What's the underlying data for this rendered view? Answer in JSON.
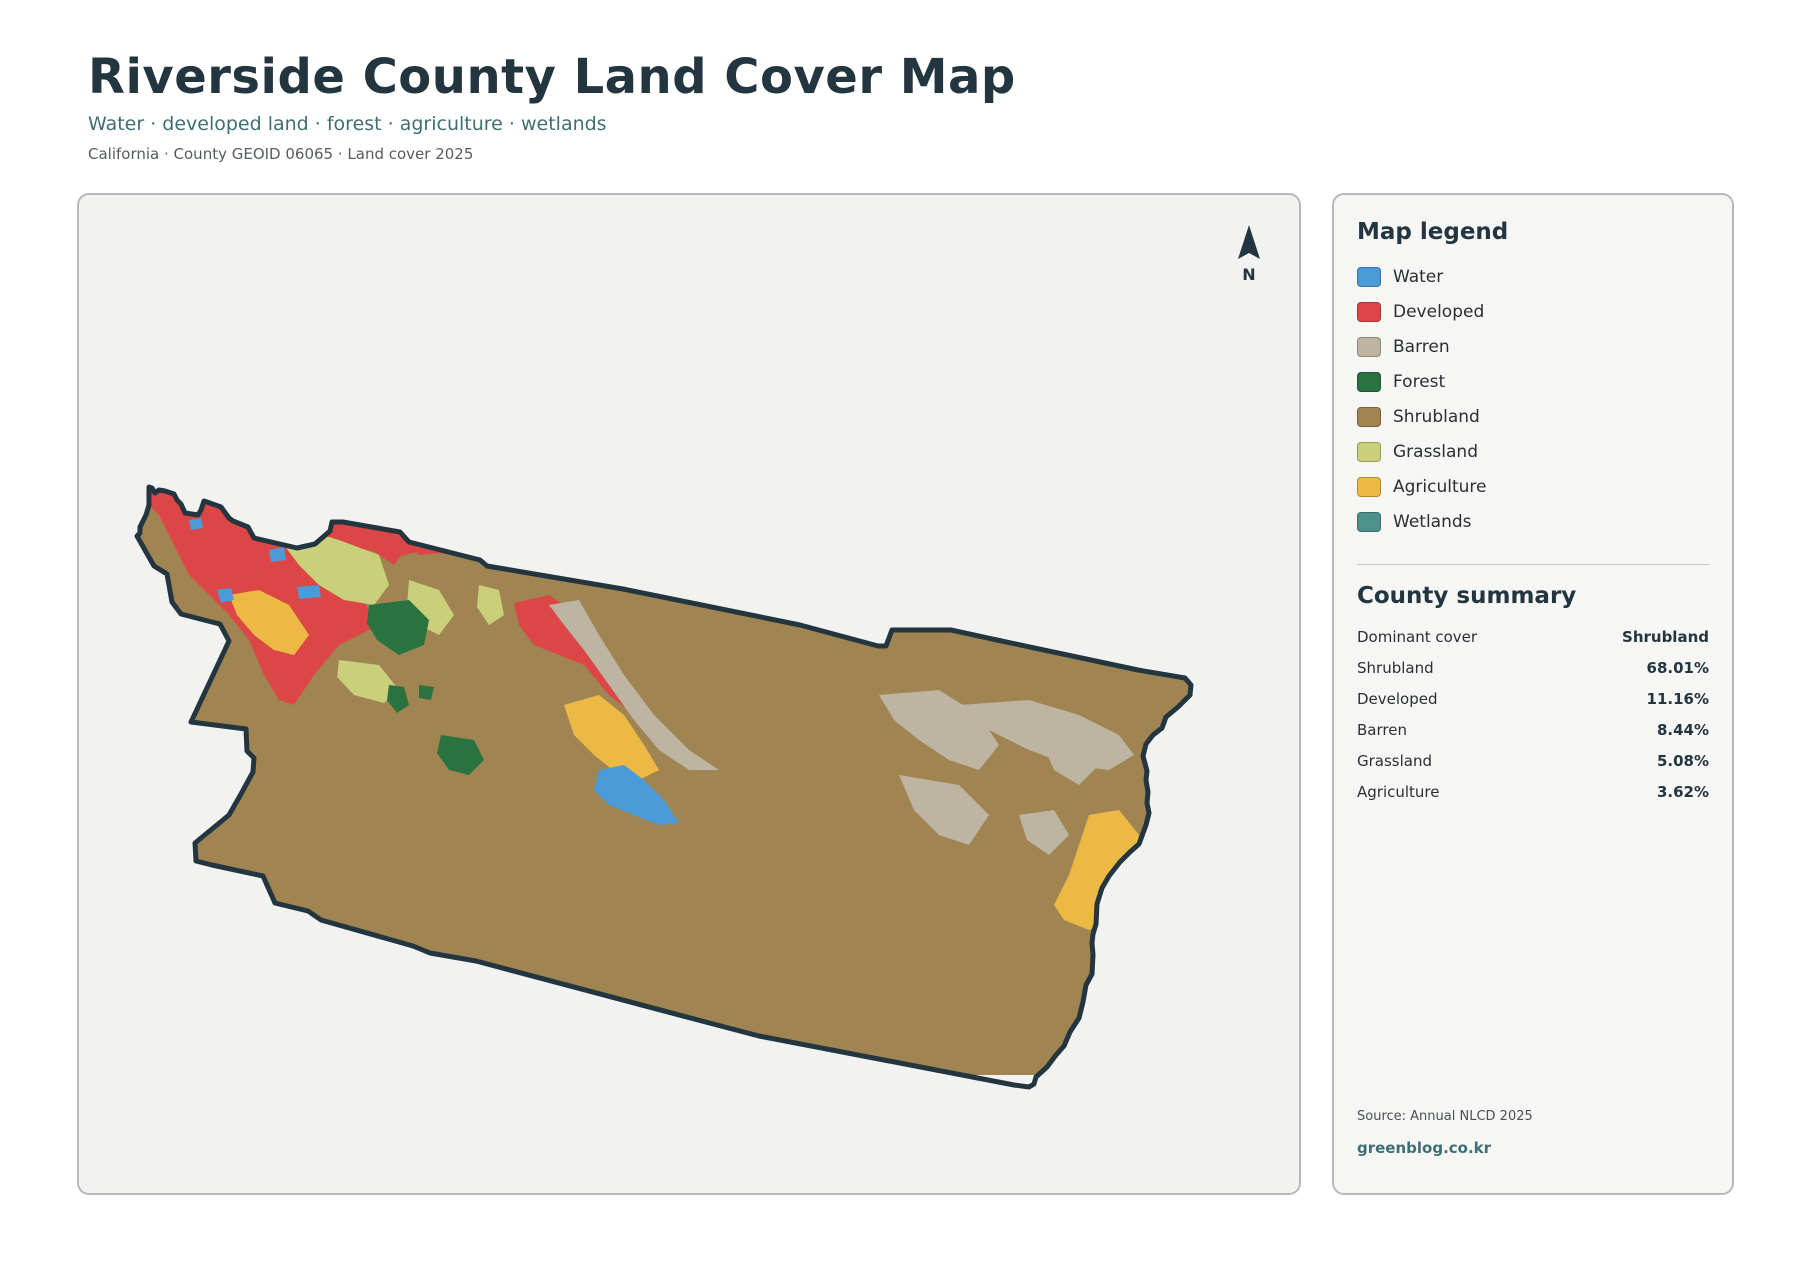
{
  "header": {
    "title": "Riverside County Land Cover Map",
    "subtitle": "Water · developed land · forest · agriculture · wetlands",
    "meta": "California · County GEOID 06065 · Land cover 2025"
  },
  "map": {
    "north_label": "N",
    "land_cover_colors": {
      "water": "#4a9bd8",
      "developed": "#dc4646",
      "barren": "#bdb4a2",
      "forest": "#2a7240",
      "shrubland": "#a08552",
      "grassland": "#cad07a",
      "agriculture": "#ecba44",
      "wetlands": "#4e918c"
    },
    "boundary_color": "#23363f"
  },
  "legend": {
    "title": "Map legend",
    "items": [
      {
        "label": "Water",
        "color": "#4a9bd8"
      },
      {
        "label": "Developed",
        "color": "#dc4646"
      },
      {
        "label": "Barren",
        "color": "#bdb4a2"
      },
      {
        "label": "Forest",
        "color": "#2a7240"
      },
      {
        "label": "Shrubland",
        "color": "#a08552"
      },
      {
        "label": "Grassland",
        "color": "#cad07a"
      },
      {
        "label": "Agriculture",
        "color": "#ecba44"
      },
      {
        "label": "Wetlands",
        "color": "#4e918c"
      }
    ]
  },
  "summary": {
    "title": "County summary",
    "rows": [
      {
        "label": "Dominant cover",
        "value": "Shrubland"
      },
      {
        "label": "Shrubland",
        "value": "68.01%"
      },
      {
        "label": "Developed",
        "value": "11.16%"
      },
      {
        "label": "Barren",
        "value": "8.44%"
      },
      {
        "label": "Grassland",
        "value": "5.08%"
      },
      {
        "label": "Agriculture",
        "value": "3.62%"
      }
    ]
  },
  "footer": {
    "source": "Source: Annual NLCD 2025",
    "site": "greenblog.co.kr"
  }
}
